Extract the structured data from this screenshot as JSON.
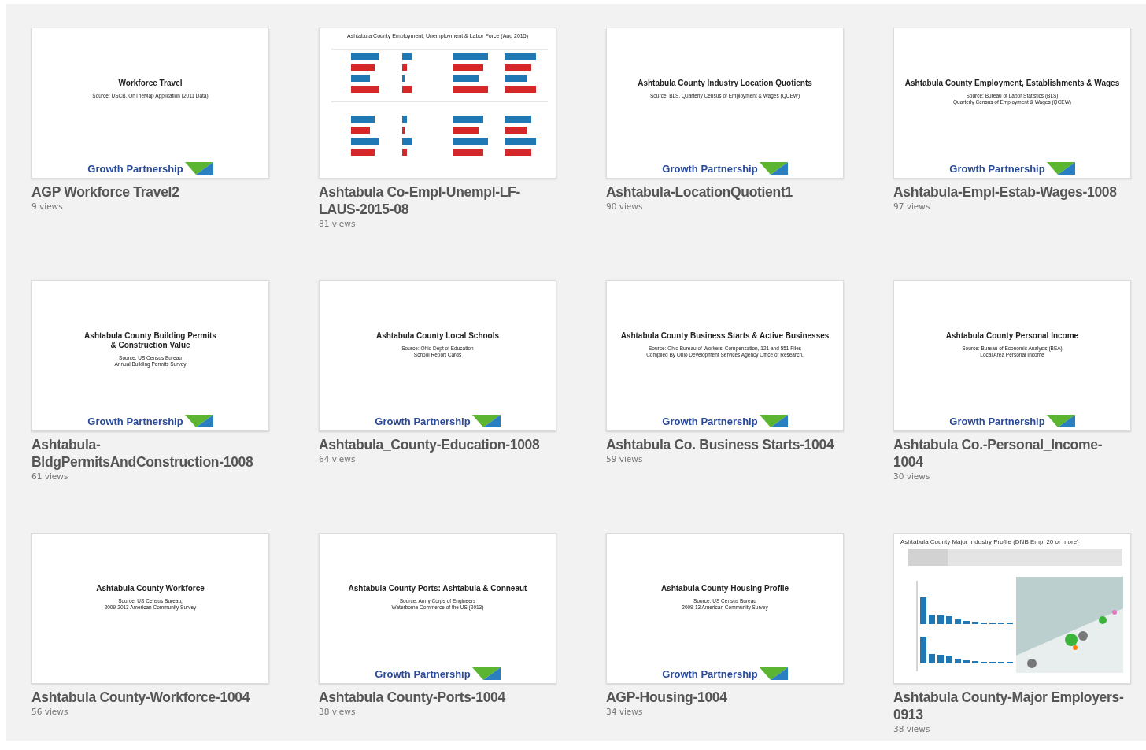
{
  "workbooks": [
    {
      "title": "AGP Workforce Travel2",
      "views": "9 views",
      "preview": {
        "kind": "slide",
        "heading_lines": [
          "Workforce Travel"
        ],
        "source_lines": [
          "Source: USCB, OnTheMap Application (2011 Data)"
        ],
        "logo": {
          "text": "Growth Partnership"
        }
      }
    },
    {
      "title": "Ashtabula Co-Empl-Unempl-LF-LAUS-2015-08",
      "views": "81 views",
      "preview": {
        "kind": "bar_chart",
        "heading_lines": [
          "Ashtabula County Employment, Unemployment & Labor Force (Aug 2015)"
        ]
      }
    },
    {
      "title": "Ashtabula-LocationQuotient1",
      "views": "90 views",
      "preview": {
        "kind": "slide",
        "heading_lines": [
          "Ashtabula County Industry Location Quotients"
        ],
        "source_lines": [
          "Source: BLS, Quarterly Census of Employment & Wages (QCEW)"
        ],
        "logo": {
          "text": "Growth Partnership"
        }
      }
    },
    {
      "title": "Ashtabula-Empl-Estab-Wages-1008",
      "views": "97 views",
      "preview": {
        "kind": "slide",
        "heading_lines": [
          "Ashtabula County Employment, Establishments & Wages"
        ],
        "source_lines": [
          "Source: Bureau of Labor Statistics (BLS)",
          "Quarterly Census of Employment & Wages (QCEW)"
        ],
        "logo": {
          "text": "Growth Partnership"
        }
      }
    },
    {
      "title": "Ashtabula-BldgPermitsAndConstruction-1008",
      "views": "61 views",
      "preview": {
        "kind": "slide",
        "heading_lines": [
          "Ashtabula County Building Permits",
          "& Construction Value"
        ],
        "source_lines": [
          "Source: US Census Bureau",
          "Annual Building Permits Survey"
        ],
        "logo": {
          "text": "Growth Partnership"
        }
      }
    },
    {
      "title": "Ashtabula_County-Education-1008",
      "views": "64 views",
      "preview": {
        "kind": "slide",
        "heading_lines": [
          "Ashtabula County Local Schools"
        ],
        "source_lines": [
          "Source: Ohio Dept of Education",
          "School Report Cards"
        ],
        "logo": {
          "text": "Growth Partnership"
        }
      }
    },
    {
      "title": "Ashtabula Co. Business Starts-1004",
      "views": "59 views",
      "preview": {
        "kind": "slide",
        "heading_lines": [
          "Ashtabula County Business Starts & Active Businesses"
        ],
        "source_lines": [
          "Source: Ohio Bureau of Workers' Compensation, 121 and 551 Files",
          "Compiled By Ohio Development Services Agency Office of Research."
        ],
        "logo": {
          "text": "Growth Partnership"
        }
      }
    },
    {
      "title": "Ashtabula Co.-Personal_Income-1004",
      "views": "30 views",
      "preview": {
        "kind": "slide",
        "heading_lines": [
          "Ashtabula County Personal Income"
        ],
        "source_lines": [
          "Source: Bureau of Economic Analysis (BEA)",
          "Local Area Personal Income"
        ],
        "logo": {
          "text": "Growth Partnership"
        }
      }
    },
    {
      "title": "Ashtabula County-Workforce-1004",
      "views": "56 views",
      "preview": {
        "kind": "slide",
        "heading_lines": [
          "Ashtabula County Workforce"
        ],
        "source_lines": [
          "Source: US Census Bureau,",
          "2009-2013 American Community Survey"
        ]
      }
    },
    {
      "title": "Ashtabula County-Ports-1004",
      "views": "38 views",
      "preview": {
        "kind": "slide",
        "heading_lines": [
          "Ashtabula County Ports: Ashtabula & Conneaut"
        ],
        "source_lines": [
          "Source: Army Corps of Engineers",
          "Waterborne Commerce of the US (2013)"
        ],
        "logo": {
          "text": "Growth Partnership"
        }
      }
    },
    {
      "title": "AGP-Housing-1004",
      "views": "34 views",
      "preview": {
        "kind": "slide",
        "heading_lines": [
          "Ashtabula County Housing Profile"
        ],
        "source_lines": [
          "Source: US Census Bureau",
          "2009-13 American Community Survey"
        ],
        "logo": {
          "text": "Growth Partnership"
        }
      }
    },
    {
      "title": "Ashtabula County-Major Employers-0913",
      "views": "38 views",
      "preview": {
        "kind": "dashboard",
        "heading_lines": [
          "Ashtabula County Major Industry Profile (DNB Empl 20 or more)"
        ]
      }
    }
  ]
}
